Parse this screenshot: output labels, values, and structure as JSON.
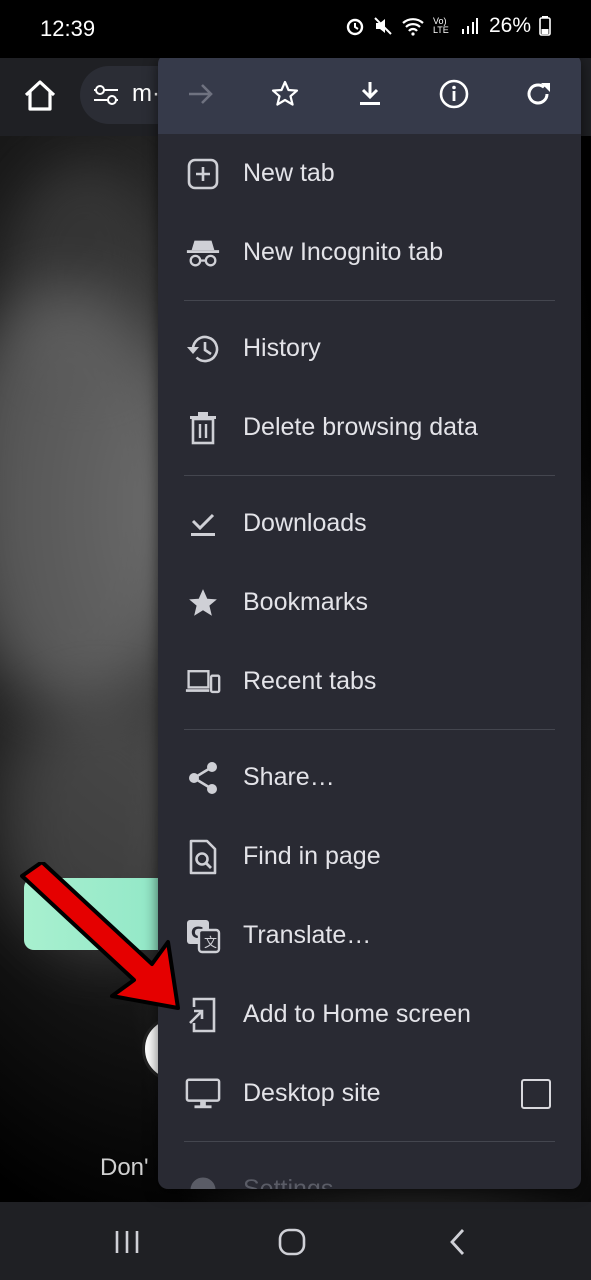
{
  "status": {
    "time": "12:39",
    "battery_percent": "26%",
    "network_label": "Vo) LTE"
  },
  "toolbar": {
    "url_partial": "m·"
  },
  "menu": {
    "top_actions": [
      "forward-icon",
      "bookmark-star-icon",
      "download-icon",
      "info-icon",
      "refresh-icon"
    ],
    "items": [
      {
        "label": "New tab",
        "icon": "new-tab-icon"
      },
      {
        "label": "New Incognito tab",
        "icon": "incognito-icon"
      },
      {
        "label": "History",
        "icon": "history-icon"
      },
      {
        "label": "Delete browsing data",
        "icon": "trash-icon"
      },
      {
        "label": "Downloads",
        "icon": "downloads-icon"
      },
      {
        "label": "Bookmarks",
        "icon": "star-icon"
      },
      {
        "label": "Recent tabs",
        "icon": "devices-icon"
      },
      {
        "label": "Share…",
        "icon": "share-icon"
      },
      {
        "label": "Find in page",
        "icon": "find-icon"
      },
      {
        "label": "Translate…",
        "icon": "translate-icon"
      },
      {
        "label": "Add to Home screen",
        "icon": "add-to-home-icon"
      },
      {
        "label": "Desktop site",
        "icon": "desktop-icon",
        "checked": false
      },
      {
        "label": "Settings",
        "icon": "gear-icon"
      }
    ]
  },
  "page": {
    "partial_text": "Don'"
  },
  "colors": {
    "menu_bg": "#292a33",
    "menu_top_bg": "#363a4a",
    "annotation_arrow": "#e50000"
  }
}
